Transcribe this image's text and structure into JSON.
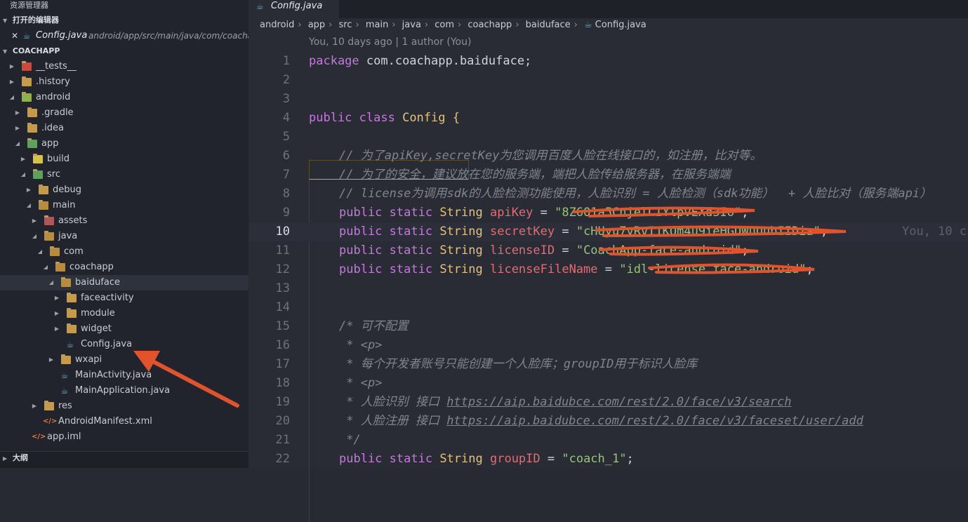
{
  "explorer": {
    "title": "资源管理器",
    "open_editors_label": "打开的编辑器",
    "open_editor": {
      "name": "Config.java",
      "path": "android/app/src/main/java/com/coacha..."
    },
    "project_label": "COACHAPP",
    "outline_label": "大纲",
    "tree": {
      "tests": "__tests__",
      "history": ".history",
      "android": "android",
      "gradle": ".gradle",
      "idea": ".idea",
      "app": "app",
      "build": "build",
      "src": "src",
      "debug": "debug",
      "main": "main",
      "assets": "assets",
      "java": "java",
      "com": "com",
      "coachapp": "coachapp",
      "baiduface": "baiduface",
      "faceactivity": "faceactivity",
      "module": "module",
      "widget": "widget",
      "config": "Config.java",
      "wxapi": "wxapi",
      "mainactivity": "MainActivity.java",
      "mainapplication": "MainApplication.java",
      "res": "res",
      "manifest": "AndroidManifest.xml",
      "appiml": "app.iml"
    }
  },
  "editor": {
    "tab_label": "Config.java",
    "breadcrumbs": [
      "android",
      "app",
      "src",
      "main",
      "java",
      "com",
      "coachapp",
      "baiduface",
      "Config.java"
    ],
    "blame": "You, 10 days ago | 1 author (You)",
    "inline_blame": "You, 10 c",
    "lines": {
      "l1_kw": "package",
      "l1_rest": " com.coachapp.baiduface;",
      "l4_kw": "public class",
      "l4_name": "Config",
      "l4_brace": " {",
      "l6": "// 为了apiKey,secretKey为您调用百度人脸在线接口的，如注册，比对等。",
      "l7": "// 为了的安全，建议放在您的服务端，端把人脸传给服务器，在服务端端",
      "l8": "// license为调用sdk的人脸检测功能使用，人脸识别 = 人脸检测（sdk功能）  + 人脸比对（服务端api）",
      "ps": "public static",
      "string_type": "String",
      "l9_name": "apiKey",
      "l9_val": "\"8Z6O1a5CnjelCIYlpvEXd3Io\"",
      "l10_name": "secretKey",
      "l10_val": "\"cHUyu7vRvI1KQm4u9ieHGDWuUubIIDia\"",
      "l11_name": "licenseID",
      "l11_val": "\"CoachApp-face-android\"",
      "l12_name": "licenseFileName",
      "l12_val": "\"idl-license.face-android\"",
      "l15": "/* 可不配置",
      "l16": " * <p>",
      "l17": " * 每个开发者账号只能创建一个人脸库；groupID用于标识人脸库",
      "l18": " * <p>",
      "l19_pre": " * 人脸识别 接口 ",
      "l19_url": "https://aip.baidubce.com/rest/2.0/face/v3/search",
      "l20_pre": " * 人脸注册 接口 ",
      "l20_url": "https://aip.baidubce.com/rest/2.0/face/v3/faceset/user/add",
      "l21": " */",
      "l22_name": "groupID",
      "l22_val": "\"coach_1\"",
      "eq": " = ",
      "semi": ";"
    },
    "line_numbers": [
      "1",
      "2",
      "3",
      "4",
      "5",
      "6",
      "7",
      "8",
      "9",
      "10",
      "11",
      "12",
      "13",
      "14",
      "15",
      "16",
      "17",
      "18",
      "19",
      "20",
      "21",
      "22"
    ],
    "current_line": "10"
  },
  "colors": {
    "keyword": "#c678dd",
    "type": "#e5c07b",
    "identifier": "#e06c75",
    "string": "#98c379",
    "annotation": "#e2532d"
  }
}
